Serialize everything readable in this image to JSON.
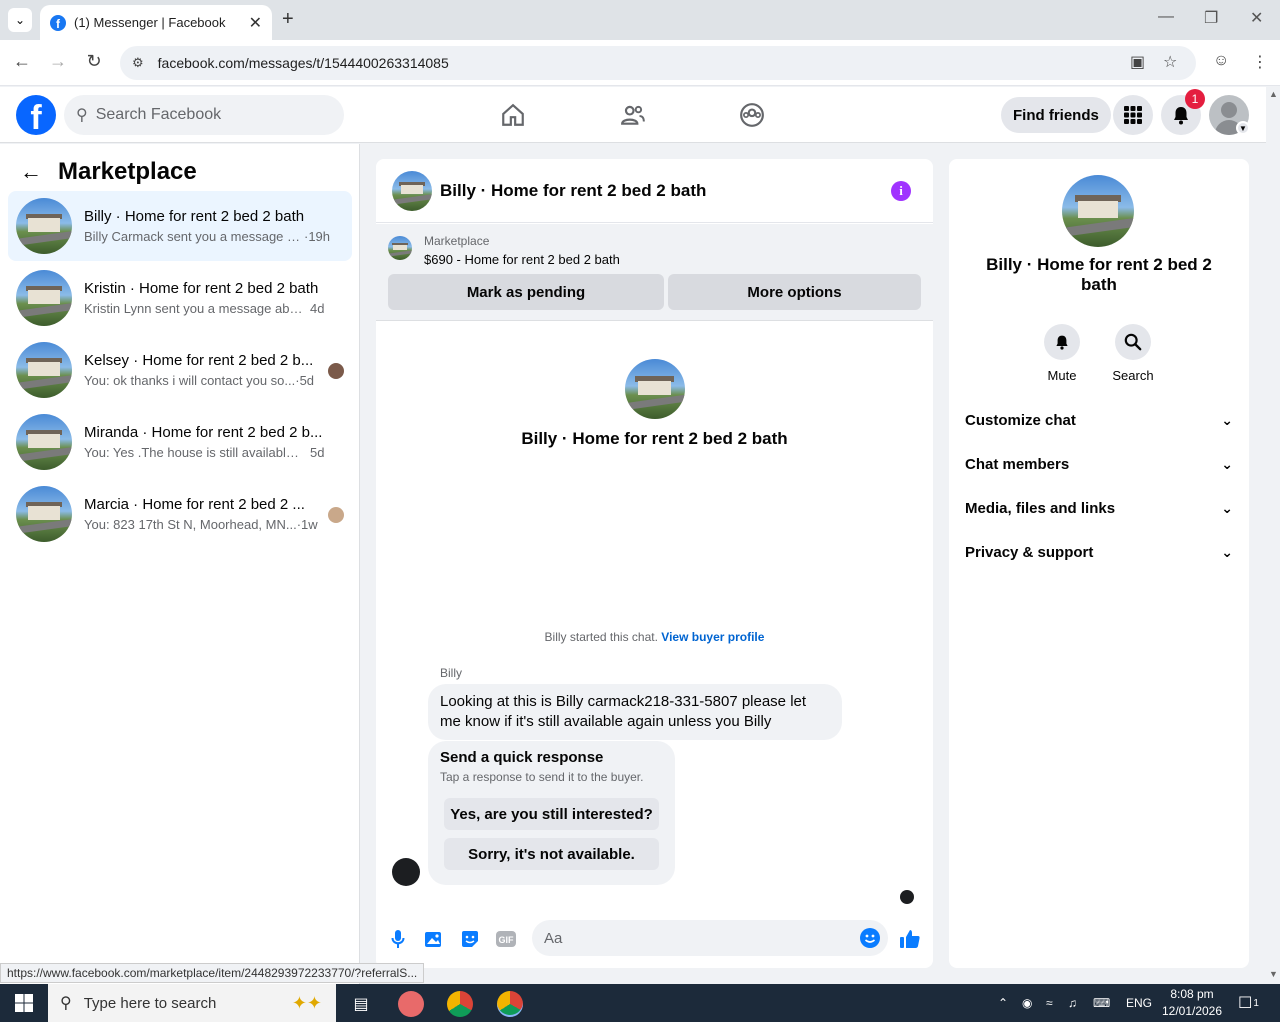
{
  "browser": {
    "tab_title": "(1) Messenger | Facebook",
    "url": "facebook.com/messages/t/1544400263314085",
    "status_url": "https://www.facebook.com/marketplace/item/2448293972233770/?referralS..."
  },
  "header": {
    "search_placeholder": "Search Facebook",
    "find_friends": "Find friends",
    "notification_count": "1"
  },
  "sidebar": {
    "title": "Marketplace",
    "conversations": [
      {
        "name": "Billy · Home for rent 2 bed 2 bath",
        "preview": "Billy Carmack sent you a message ab...",
        "time": "·19h",
        "active": true
      },
      {
        "name": "Kristin · Home for rent 2 bed 2 bath",
        "preview": "Kristin Lynn sent you a message abou...",
        "time": "4d"
      },
      {
        "name": "Kelsey · Home for rent 2 bed 2 b...",
        "preview": "You: ok thanks i will contact you so...",
        "time": "·5d"
      },
      {
        "name": "Miranda · Home for rent 2 bed 2 b...",
        "preview": "You: Yes .The house is still available fo...",
        "time": "5d"
      },
      {
        "name": "Marcia · Home for rent 2 bed 2 ...",
        "preview": "You: 823 17th St N, Moorhead, MN...",
        "time": "·1w"
      }
    ]
  },
  "chat": {
    "title": "Billy · Home for rent 2 bed 2 bath",
    "marketplace_label": "Marketplace",
    "marketplace_item": "$690 - Home for rent 2 bed 2 bath",
    "mark_pending": "Mark as pending",
    "more_options": "More options",
    "center_name": "Billy · Home for rent 2 bed 2 bath",
    "started_text": "Billy started this chat.",
    "view_profile": "View buyer profile",
    "sender": "Billy",
    "message": "Looking at this is Billy carmack218-331-5807 please let me know if it's still available again unless you Billy",
    "quick_title": "Send a quick response",
    "quick_sub": "Tap a response to send it to the buyer.",
    "quick_reply_1": "Yes, are you still interested?",
    "quick_reply_2": "Sorry, it's not available.",
    "input_placeholder": "Aa"
  },
  "right_panel": {
    "name": "Billy · Home for rent 2 bed 2 bath",
    "mute": "Mute",
    "search": "Search",
    "sections": [
      "Customize chat",
      "Chat members",
      "Media, files and links",
      "Privacy & support"
    ]
  },
  "taskbar": {
    "search_text": "Type here to search",
    "language": "ENG",
    "time": "8:08 pm",
    "date": "12/01/2026",
    "notif_count": "1"
  }
}
